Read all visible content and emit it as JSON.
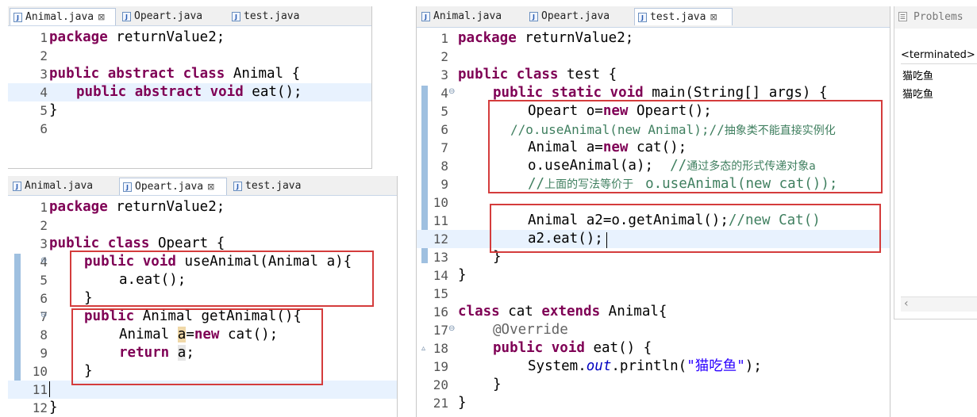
{
  "editors": {
    "animal": {
      "tabs": [
        {
          "label": "Animal.java",
          "close": "⊠"
        },
        {
          "label": "Opeart.java"
        },
        {
          "label": "test.java"
        }
      ],
      "lines": [
        {
          "n": "1"
        },
        {
          "n": "2"
        },
        {
          "n": "3"
        },
        {
          "n": "4"
        },
        {
          "n": "5"
        },
        {
          "n": "6"
        }
      ],
      "code": {
        "l1_kw": "package",
        "l1_rest": " returnValue2;",
        "l3_kw1": "public",
        "l3_kw2": "abstract",
        "l3_kw3": "class",
        "l3_rest": " Animal {",
        "l4_kw1": "public",
        "l4_kw2": "abstract",
        "l4_kw3": "void",
        "l4_rest": " eat();",
        "l5": "}"
      }
    },
    "opeart": {
      "tabs": [
        {
          "label": "Animal.java"
        },
        {
          "label": "Opeart.java",
          "close": "⊠"
        },
        {
          "label": "test.java"
        }
      ],
      "lines": [
        {
          "n": "1"
        },
        {
          "n": "2"
        },
        {
          "n": "3"
        },
        {
          "n": "4"
        },
        {
          "n": "5"
        },
        {
          "n": "6"
        },
        {
          "n": "7"
        },
        {
          "n": "8"
        },
        {
          "n": "9"
        },
        {
          "n": "10"
        },
        {
          "n": "11"
        },
        {
          "n": "12"
        }
      ],
      "code": {
        "l1_kw": "package",
        "l1_rest": " returnValue2;",
        "l3_kw1": "public",
        "l3_kw2": "class",
        "l3_rest": " Opeart {",
        "l4_kw1": "public",
        "l4_kw2": "void",
        "l4_rest": " useAnimal(Animal a){",
        "l5": "a.eat();",
        "l6": "}",
        "l7_kw": "public",
        "l7_rest": " Animal getAnimal(){",
        "l8_a": "Animal ",
        "l8_var": "a",
        "l8_eq": "=",
        "l8_kw": "new",
        "l8_rest": " cat();",
        "l9_kw": "return",
        "l9_sp": " ",
        "l9_var": "a",
        "l9_rest": ";",
        "l10": "}",
        "l12": "}"
      }
    },
    "test": {
      "tabs": [
        {
          "label": "Animal.java"
        },
        {
          "label": "Opeart.java"
        },
        {
          "label": "test.java",
          "close": "⊠"
        }
      ],
      "lines": [
        {
          "n": "1"
        },
        {
          "n": "2"
        },
        {
          "n": "3"
        },
        {
          "n": "4"
        },
        {
          "n": "5"
        },
        {
          "n": "6"
        },
        {
          "n": "7"
        },
        {
          "n": "8"
        },
        {
          "n": "9"
        },
        {
          "n": "10"
        },
        {
          "n": "11"
        },
        {
          "n": "12"
        },
        {
          "n": "13"
        },
        {
          "n": "14"
        },
        {
          "n": "15"
        },
        {
          "n": "16"
        },
        {
          "n": "17"
        },
        {
          "n": "18"
        },
        {
          "n": "19"
        },
        {
          "n": "20"
        },
        {
          "n": "21"
        }
      ],
      "code": {
        "l1_kw": "package",
        "l1_rest": " returnValue2;",
        "l3_kw1": "public",
        "l3_kw2": "class",
        "l3_rest": " test {",
        "l4_kw1": "public",
        "l4_kw2": "static",
        "l4_kw3": "void",
        "l4_rest": " main(String[] args) {",
        "l5_a": "Opeart o=",
        "l5_kw": "new",
        "l5_rest": " Opeart();",
        "l6_cm": "//o.useAnimal(new Animal);//",
        "l6_cjk": "抽象类不能直接实例化",
        "l7_a": "Animal a=",
        "l7_kw": "new",
        "l7_rest": " cat();",
        "l8_code": "o.useAnimal(a);  ",
        "l8_cm": "//",
        "l8_cjk": "通过多态的形式传递对象a",
        "l9_cm1": "//",
        "l9_cjk": "上面的写法等价于 ",
        "l9_cm2": " o.useAnimal(new cat());",
        "l11_code": "Animal a2=o.getAnimal();",
        "l11_cm": "//new Cat()",
        "l12_code": "a2.eat();",
        "l13": "}",
        "l14": "}",
        "l16_kw1": "class",
        "l16_mid": " cat ",
        "l16_kw2": "extends",
        "l16_rest": " Animal{",
        "l17_ann": "@Override",
        "l18_kw1": "public",
        "l18_kw2": "void",
        "l18_rest": " eat() {",
        "l19_a": "System.",
        "l19_fld": "out",
        "l19_b": ".println(",
        "l19_str": "\"猫吃鱼\"",
        "l19_c": ");",
        "l20": "}",
        "l21": "}"
      }
    }
  },
  "console": {
    "tab_label": "Problems",
    "status": "<terminated>",
    "output": [
      "猫吃鱼",
      "猫吃鱼"
    ]
  },
  "icons": {
    "java_file": "java-file-icon",
    "close": "close-icon",
    "problems": "problems-icon",
    "scroll_left": "‹"
  }
}
